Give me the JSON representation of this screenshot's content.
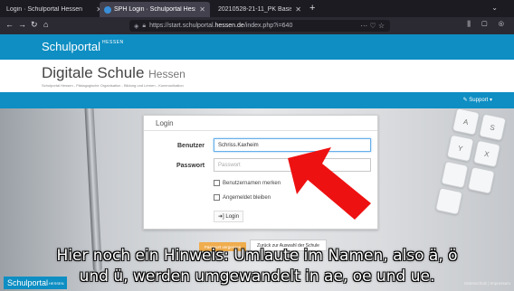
{
  "browser": {
    "tabs": [
      {
        "label": "Login · Schulportal Hessen",
        "active": false
      },
      {
        "label": "SPH Login · Schulportal Hesse",
        "active": true
      },
      {
        "label": "20210528-21-11_PK Basisanl",
        "active": false
      }
    ],
    "new_tab": "+",
    "url_prefix": "https://start.schulportal.",
    "url_domain": "hessen.de",
    "url_suffix": "/index.php?i=640",
    "url_tail": "··· ♡ ☆"
  },
  "site": {
    "brand": "Schulportal",
    "brand_sup": "HESSEN",
    "title": "Digitale Schule",
    "title_suffix": "Hessen",
    "subtitle": "Schulportal Hessen - Pädagogische Organisation - Bildung und Lernen - Kommunikation",
    "support": "✎ Support ▾"
  },
  "login": {
    "title": "Login",
    "username_label": "Benutzer",
    "username_value": "Schriss.Kaxheim",
    "password_label": "Passwort",
    "password_placeholder": "Passwort",
    "remember_label": "Benutzernamen merken",
    "stay_label": "Angemeldet bleiben",
    "login_button": "➜] Login"
  },
  "buttons": {
    "forgot": "Passwort vergessen",
    "back": "Zurück zur Auswahl der Schule"
  },
  "subtitles": {
    "line1": "Hier noch ein Hinweis: Umlaute im Namen, also ä, ö",
    "line2": "und ü, werden umgewandelt in ae, oe und ue."
  },
  "footer": {
    "logo": "Schulportal",
    "logo_sup": "HESSEN",
    "links": "Datenschutz | Impressum"
  },
  "colors": {
    "brand_blue": "#0e8ec3",
    "arrow_red": "#ee1111",
    "forgot_orange": "#f0ad4e"
  }
}
